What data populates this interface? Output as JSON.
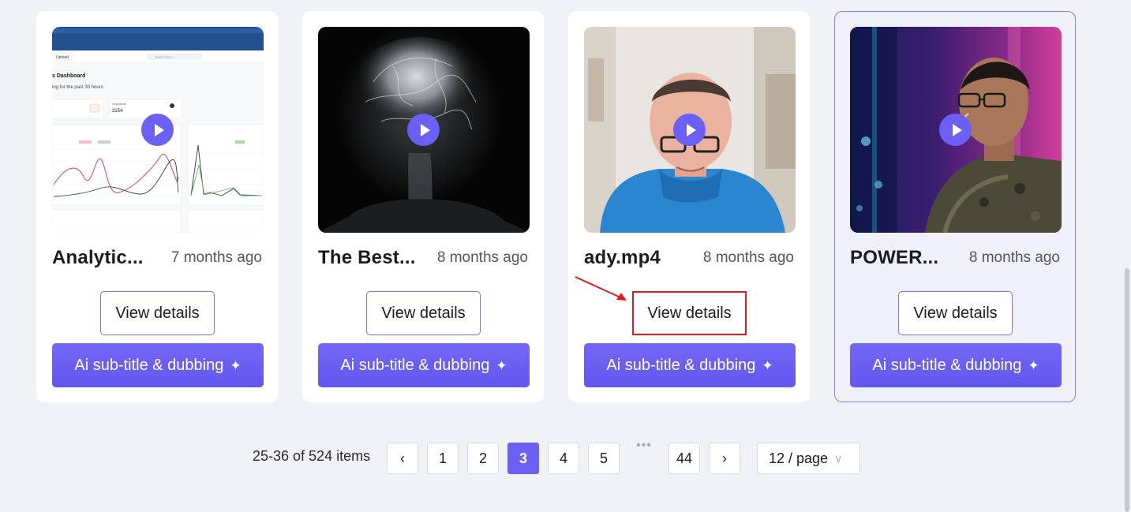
{
  "cards": [
    {
      "title": "Analytic...",
      "date": "7 months ago",
      "view_label": "View details",
      "ai_label": "Ai sub-title & dubbing",
      "thumb": "dashboard-screenshot",
      "selected": false
    },
    {
      "title": "The Best...",
      "date": "8 months ago",
      "view_label": "View details",
      "ai_label": "Ai sub-title & dubbing",
      "thumb": "brain-xray",
      "selected": false
    },
    {
      "title": "ady.mp4",
      "date": "8 months ago",
      "view_label": "View details",
      "ai_label": "Ai sub-title & dubbing",
      "thumb": "man-in-blue-hoodie",
      "selected": false,
      "highlighted_view_button": true
    },
    {
      "title": "POWER...",
      "date": "8 months ago",
      "view_label": "View details",
      "ai_label": "Ai sub-title & dubbing",
      "thumb": "speaker-on-stage",
      "selected": true
    }
  ],
  "dashboard_thumb": {
    "tab_label": "Upload",
    "search_placeholder": "Search here",
    "heading": "s Dashboard",
    "subheading": "ing for the past 30 hours",
    "stat_label": "Keywords",
    "stat_value": "3154"
  },
  "pagination": {
    "total_text": "25-36 of 524 items",
    "prev_icon": "chevron-left-icon",
    "next_icon": "chevron-right-icon",
    "pages": [
      "1",
      "2",
      "3",
      "4",
      "5"
    ],
    "current": "3",
    "ellipsis": "•••",
    "last": "44",
    "page_size": "12 / page"
  },
  "colors": {
    "accent": "#6b5ff4",
    "highlight": "#e01b1b",
    "background": "#f1f2f6"
  }
}
